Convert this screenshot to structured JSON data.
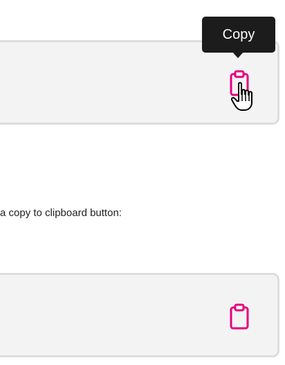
{
  "tooltip": {
    "text": "Copy"
  },
  "description": {
    "text": "a copy to clipboard button:"
  },
  "colors": {
    "accent": "#e6007e",
    "tooltip_bg": "#1c1c1c",
    "box_bg": "#f3f3f3",
    "box_border": "#dddddd"
  },
  "icons": {
    "copy": "clipboard-icon",
    "cursor": "hand-pointer-icon"
  }
}
